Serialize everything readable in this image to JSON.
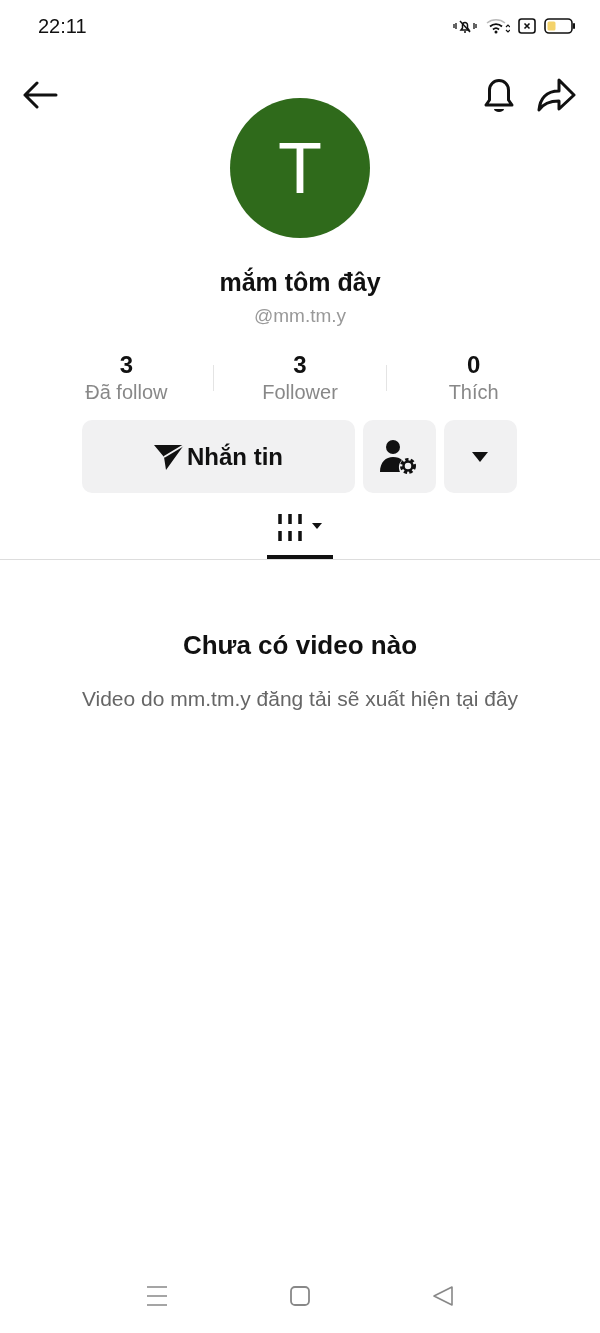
{
  "status_bar": {
    "time": "22:11"
  },
  "profile": {
    "avatar_letter": "T",
    "name": "mắm tôm đây",
    "handle": "@mm.tm.y"
  },
  "stats": [
    {
      "value": "3",
      "label": "Đã follow"
    },
    {
      "value": "3",
      "label": "Follower"
    },
    {
      "value": "0",
      "label": "Thích"
    }
  ],
  "message_button": "Nhắn tin",
  "tabs": [
    {
      "kind": "videos",
      "selected": true
    }
  ],
  "empty_state": {
    "title": "Chưa có video nào",
    "description": "Video do mm.tm.y đăng tải sẽ xuất hiện tại đây"
  }
}
